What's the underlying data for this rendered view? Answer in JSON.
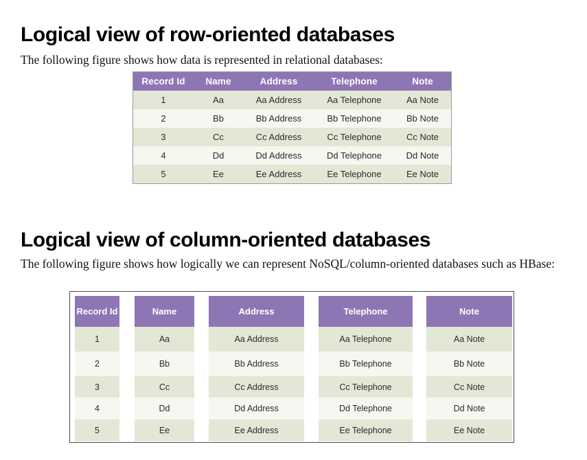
{
  "sections": {
    "row_oriented": {
      "heading": "Logical view of row-oriented databases",
      "paragraph": "The following figure shows how data is represented in relational databases:"
    },
    "column_oriented": {
      "heading": "Logical view of column-oriented databases",
      "paragraph": "The following figure shows how logically we can represent NoSQL/column-oriented databases such as HBase:"
    }
  },
  "colors": {
    "header_purple": "#8e76b4",
    "band_a": "#e2e8d5",
    "band_b": "#f5f7f0",
    "table1_border": "#9a9a9a",
    "table2_border": "#4c4c4c",
    "header_text": "#ffffff",
    "cell_text": "#2b2b2b"
  },
  "table_row_oriented": {
    "headers": [
      "Record Id",
      "Name",
      "Address",
      "Telephone",
      "Note"
    ],
    "rows": [
      [
        "1",
        "Aa",
        "Aa Address",
        "Aa Telephone",
        "Aa Note"
      ],
      [
        "2",
        "Bb",
        "Bb Address",
        "Bb Telephone",
        "Bb Note"
      ],
      [
        "3",
        "Cc",
        "Cc Address",
        "Cc Telephone",
        "Cc Note"
      ],
      [
        "4",
        "Dd",
        "Dd Address",
        "Dd Telephone",
        "Dd Note"
      ],
      [
        "5",
        "Ee",
        "Ee Address",
        "Ee Telephone",
        "Ee Note"
      ]
    ]
  },
  "table_column_oriented": {
    "columns": [
      {
        "header": "Record Id",
        "values": [
          "1",
          "2",
          "3",
          "4",
          "5"
        ]
      },
      {
        "header": "Name",
        "values": [
          "Aa",
          "Bb",
          "Cc",
          "Dd",
          "Ee"
        ]
      },
      {
        "header": "Address",
        "values": [
          "Aa Address",
          "Bb Address",
          "Cc Address",
          "Dd Address",
          "Ee Address"
        ]
      },
      {
        "header": "Telephone",
        "values": [
          "Aa Telephone",
          "Bb Telephone",
          "Cc Telephone",
          "Dd Telephone",
          "Ee Telephone"
        ]
      },
      {
        "header": "Note",
        "values": [
          "Aa Note",
          "Bb Note",
          "Cc Note",
          "Dd Note",
          "Ee Note"
        ]
      }
    ]
  }
}
